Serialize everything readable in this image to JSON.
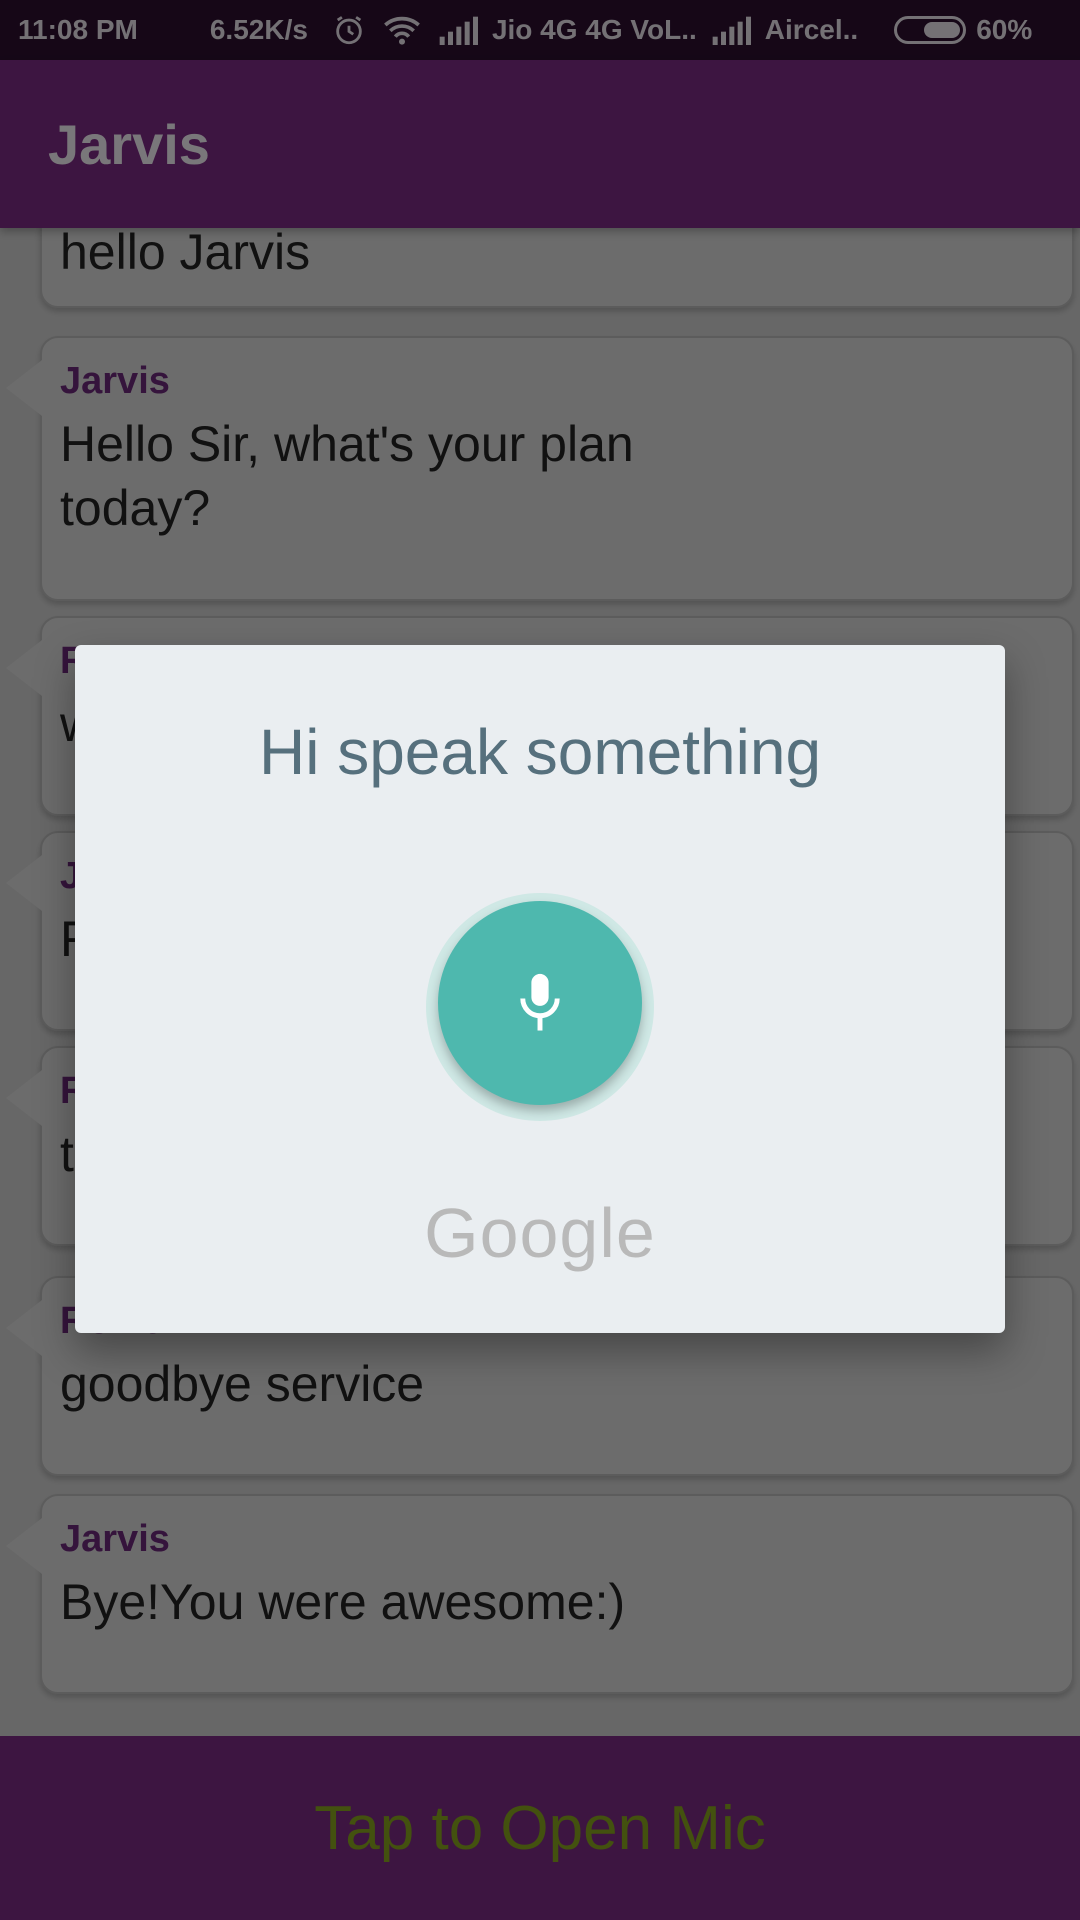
{
  "status_bar": {
    "time": "11:08 PM",
    "speed": "6.52K/s",
    "carrier1": "Jio 4G 4G  VoL..",
    "carrier2": "Aircel..",
    "battery": "60%",
    "battery_level": 0.6
  },
  "app_bar": {
    "title": "Jarvis"
  },
  "messages": [
    {
      "sender": "",
      "text": "hello Jarvis"
    },
    {
      "sender": "Jarvis",
      "text": "Hello Sir, what's your plan\ntoday?"
    },
    {
      "sender": "R",
      "text": "w"
    },
    {
      "sender": "J",
      "text": "F"
    },
    {
      "sender": "R",
      "text": "t"
    },
    {
      "sender": "Rohit",
      "text": "goodbye service"
    },
    {
      "sender": "Jarvis",
      "text": "Bye!You were awesome:)"
    }
  ],
  "bottom_bar": {
    "label": "Tap to Open Mic"
  },
  "dialog": {
    "prompt": "Hi speak something",
    "logo": "Google",
    "mic_icon": "mic-icon"
  },
  "colors": {
    "status_bar": "#2c0f2f",
    "app_bar": "#7b2a83",
    "accent_green": "#86a21e",
    "mic_teal": "#4eb8ae",
    "prompt_text": "#56707d"
  }
}
